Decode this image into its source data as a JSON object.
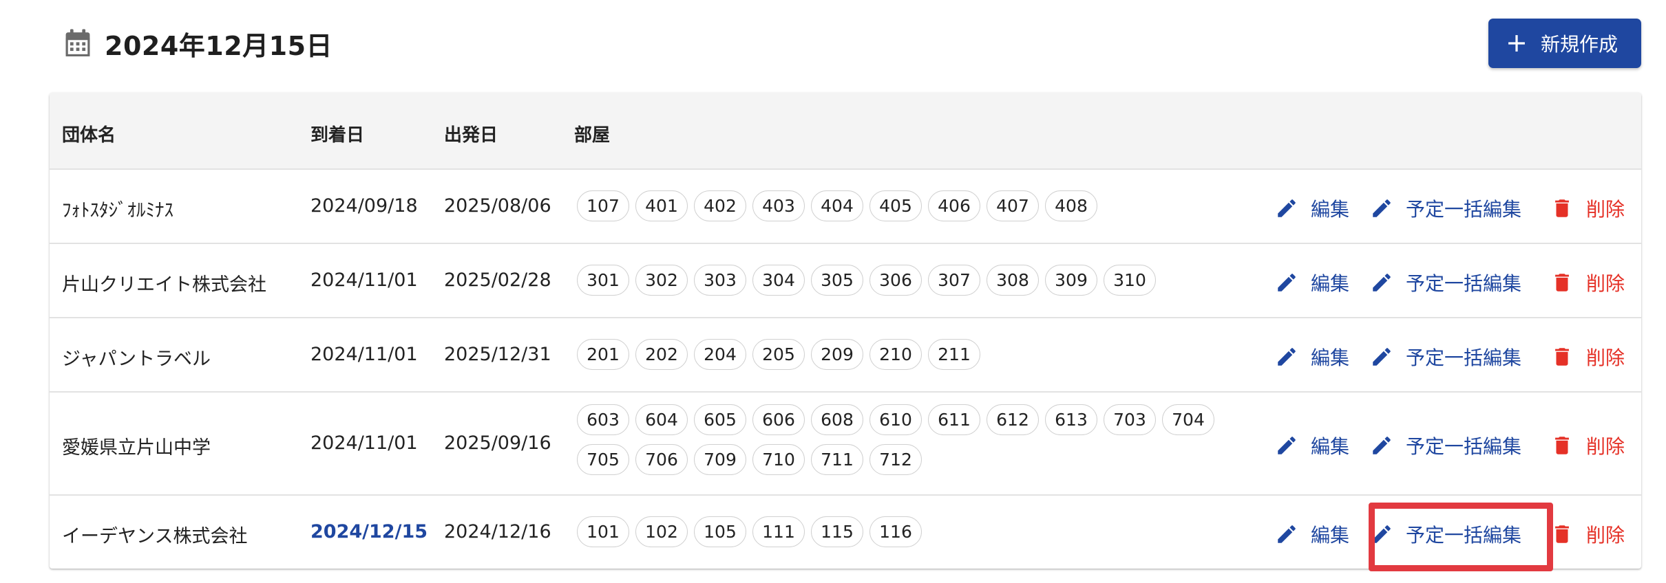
{
  "header": {
    "date_title": "2024年12月15日",
    "new_button_label": "新規作成",
    "calendar_icon": "calendar-icon",
    "plus_icon": "plus-icon"
  },
  "table": {
    "columns": [
      "団体名",
      "到着日",
      "出発日",
      "部屋"
    ],
    "actions": {
      "edit_label": "編集",
      "bulk_edit_label": "予定一括編集",
      "delete_label": "削除",
      "edit_icon": "pencil-icon",
      "delete_icon": "trash-icon"
    },
    "rows": [
      {
        "group": "ﾌｫﾄｽﾀｼﾞｵﾙﾐﾅｽ",
        "arrival": "2024/09/18",
        "departure": "2025/08/06",
        "rooms": [
          "107",
          "401",
          "402",
          "403",
          "404",
          "405",
          "406",
          "407",
          "408"
        ]
      },
      {
        "group": "片山クリエイト株式会社",
        "arrival": "2024/11/01",
        "departure": "2025/02/28",
        "rooms": [
          "301",
          "302",
          "303",
          "304",
          "305",
          "306",
          "307",
          "308",
          "309",
          "310"
        ]
      },
      {
        "group": "ジャパントラベル",
        "arrival": "2024/11/01",
        "departure": "2025/12/31",
        "rooms": [
          "201",
          "202",
          "204",
          "205",
          "209",
          "210",
          "211"
        ]
      },
      {
        "group": "愛媛県立片山中学",
        "arrival": "2024/11/01",
        "departure": "2025/09/16",
        "rooms": [
          "603",
          "604",
          "605",
          "606",
          "608",
          "610",
          "611",
          "612",
          "613",
          "703",
          "704",
          "705",
          "706",
          "709",
          "710",
          "711",
          "712"
        ]
      },
      {
        "group": "イーデヤンス株式会社",
        "arrival": "2024/12/15",
        "arrival_is_today": true,
        "departure": "2024/12/16",
        "rooms": [
          "101",
          "102",
          "105",
          "111",
          "115",
          "116"
        ]
      }
    ]
  },
  "colors": {
    "primary": "#1f47a0",
    "danger": "#e53127",
    "highlight": "#e23a40",
    "header_bg": "#f4f4f4"
  }
}
